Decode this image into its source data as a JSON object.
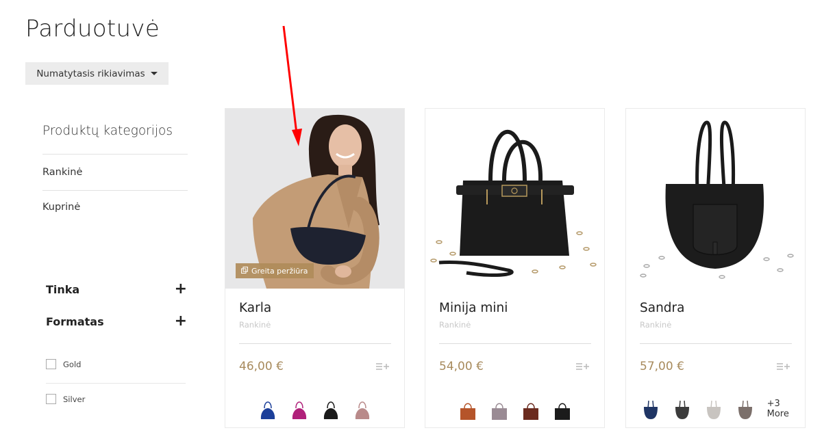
{
  "page": {
    "title": "Parduotuvė"
  },
  "sort": {
    "label": "Numatytasis rikiavimas"
  },
  "sidebar": {
    "categories_title": "Produktų kategorijos",
    "categories": [
      {
        "label": "Rankinė"
      },
      {
        "label": "Kuprinė"
      }
    ],
    "filters": [
      {
        "label": "Tinka"
      },
      {
        "label": "Formatas"
      }
    ],
    "options": [
      {
        "label": "Gold"
      },
      {
        "label": "Silver"
      }
    ]
  },
  "products": [
    {
      "name": "Karla",
      "category": "Rankinė",
      "price": "46,00 €",
      "quick_view": "Greita peržiūra",
      "swatch_colors": [
        "#1c3f9a",
        "#b0217a",
        "#1a1a1a",
        "#b98a8a"
      ]
    },
    {
      "name": "Minija mini",
      "category": "Rankinė",
      "price": "54,00 €",
      "swatch_colors": [
        "#b5542a",
        "#9a8b94",
        "#6b2b1f",
        "#1b1b1b"
      ]
    },
    {
      "name": "Sandra",
      "category": "Rankinė",
      "price": "57,00 €",
      "swatch_colors": [
        "#1f3564",
        "#3b3b3b",
        "#c8c4c0",
        "#7b6f6a"
      ],
      "more_label": "+3 More"
    }
  ],
  "colors": {
    "price": "#a78a5c",
    "quick_view_bg": "#b08c5a",
    "annotation_arrow": "#ff0000"
  }
}
